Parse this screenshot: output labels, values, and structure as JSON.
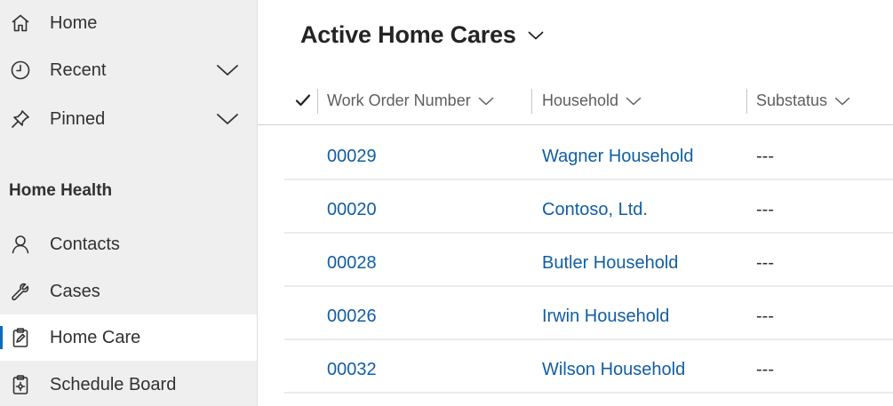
{
  "sidebar": {
    "items": [
      {
        "label": "Home",
        "icon": "home-icon"
      },
      {
        "label": "Recent",
        "icon": "clock-icon"
      },
      {
        "label": "Pinned",
        "icon": "pin-icon"
      }
    ],
    "group": {
      "title": "Home Health",
      "items": [
        {
          "label": "Contacts",
          "icon": "person-icon"
        },
        {
          "label": "Cases",
          "icon": "wrench-icon"
        },
        {
          "label": "Home Care",
          "icon": "clipboard-icon",
          "active": true
        },
        {
          "label": "Schedule Board",
          "icon": "clipboard-gear-icon"
        }
      ]
    }
  },
  "main": {
    "view_title": "Active Home Cares",
    "columns": [
      {
        "label": "Work Order Number"
      },
      {
        "label": "Household"
      },
      {
        "label": "Substatus"
      }
    ],
    "rows": [
      {
        "work_order": "00029",
        "household": "Wagner Household",
        "substatus": "---"
      },
      {
        "work_order": "00020",
        "household": "Contoso, Ltd.",
        "substatus": "---"
      },
      {
        "work_order": "00028",
        "household": "Butler Household",
        "substatus": "---"
      },
      {
        "work_order": "00026",
        "household": "Irwin Household",
        "substatus": "---"
      },
      {
        "work_order": "00032",
        "household": "Wilson Household",
        "substatus": "---"
      }
    ]
  },
  "colors": {
    "accent": "#0f6cbd",
    "link": "#115ea3",
    "sidebar_bg": "#efefef"
  }
}
